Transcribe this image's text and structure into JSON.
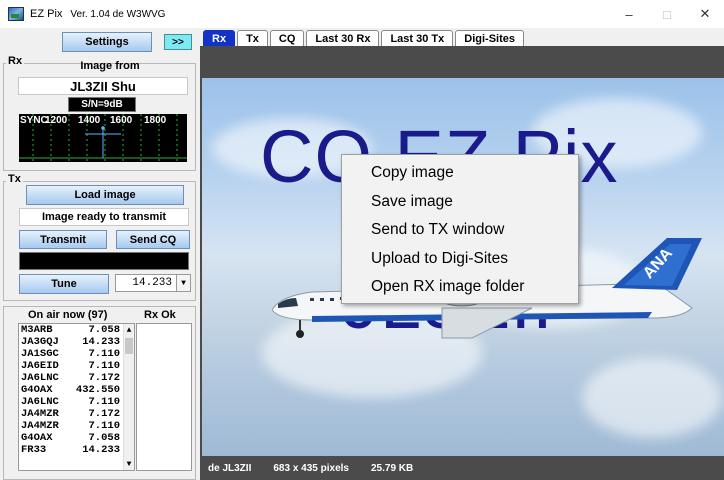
{
  "window": {
    "title": "EZ Pix",
    "version": "Ver. 1.04 de W3WVG",
    "minimize": "–",
    "maximize": "□",
    "close": "✕"
  },
  "left": {
    "settings_label": "Settings",
    "expand_label": ">>",
    "rx": {
      "label": "Rx",
      "image_from_label": "Image from",
      "image_from_value": "JL3ZII  Shu",
      "snr": "S/N=9dB",
      "spectrum_labels": [
        "SYNC",
        "1200",
        "1400",
        "1600",
        "1800"
      ]
    },
    "tx": {
      "label": "Tx",
      "load_image_label": "Load image",
      "status": "Image ready to transmit",
      "transmit_label": "Transmit",
      "send_cq_label": "Send CQ",
      "tune_label": "Tune",
      "frequency": "14.233"
    },
    "on_air": {
      "header": "On air now (97)",
      "rx_ok_header": "Rx Ok",
      "stations": [
        {
          "call": "M3ARB",
          "freq": "7.058"
        },
        {
          "call": "JA3GQJ",
          "freq": "14.233"
        },
        {
          "call": "JA1SGC",
          "freq": "7.110"
        },
        {
          "call": "JA6EID",
          "freq": "7.110"
        },
        {
          "call": "JA6LNC",
          "freq": "7.172"
        },
        {
          "call": "G4OAX",
          "freq": "432.550"
        },
        {
          "call": "JA6LNC",
          "freq": "7.110"
        },
        {
          "call": "JA4MZR",
          "freq": "7.172"
        },
        {
          "call": "JA4MZR",
          "freq": "7.110"
        },
        {
          "call": "G4OAX",
          "freq": "7.058"
        },
        {
          "call": "FR33",
          "freq": "14.233"
        }
      ]
    }
  },
  "tabs": [
    "Rx",
    "Tx",
    "CQ",
    "Last 30 Rx",
    "Last 30 Tx",
    "Digi-Sites"
  ],
  "image": {
    "line1": "CQ EZ Pix",
    "line2": "JL3ZII",
    "tail_text": "ANA"
  },
  "context_menu": [
    "Copy image",
    "Save image",
    "Send to TX window",
    "Upload to Digi-Sites",
    "Open RX image folder"
  ],
  "status": {
    "from": "de JL3ZII",
    "size": "683 x 435 pixels",
    "filesize": "25.79 KB"
  },
  "colors": {
    "tab_active": "#1232c8",
    "button_cyan": "#7fe9f3",
    "image_text": "#1a1a8a"
  }
}
